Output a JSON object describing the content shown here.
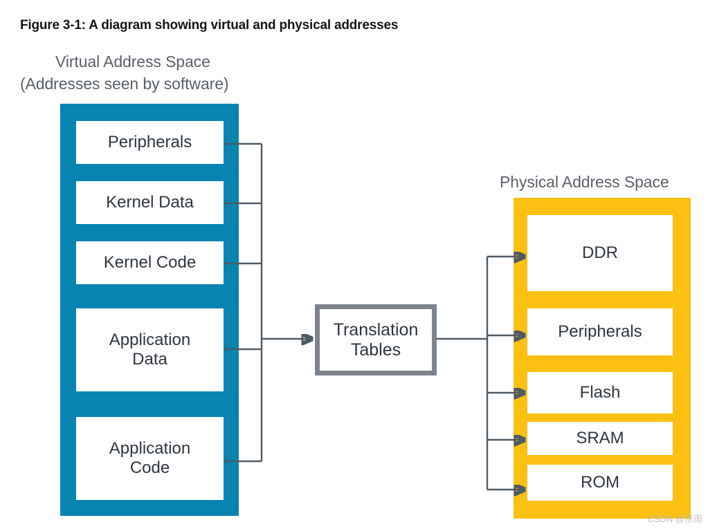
{
  "figure": {
    "caption": "Figure 3-1: A diagram showing virtual and physical addresses"
  },
  "virtual_space": {
    "title_line1": "Virtual Address Space",
    "title_line2": "(Addresses seen by software)",
    "container_color": "#0984b0",
    "blocks": [
      {
        "label": "Peripherals",
        "label_line1": "Peripherals",
        "label_line2": ""
      },
      {
        "label": "Kernel Data",
        "label_line1": "Kernel Data",
        "label_line2": ""
      },
      {
        "label": "Kernel Code",
        "label_line1": "Kernel Code",
        "label_line2": ""
      },
      {
        "label": "Application Data",
        "label_line1": "Application",
        "label_line2": "Data"
      },
      {
        "label": "Application Code",
        "label_line1": "Application",
        "label_line2": "Code"
      }
    ]
  },
  "translation": {
    "label_line1": "Translation",
    "label_line2": "Tables",
    "border_color": "#7d848c"
  },
  "physical_space": {
    "title": "Physical Address Space",
    "container_color": "#fbc011",
    "blocks": [
      {
        "label": "DDR"
      },
      {
        "label": "Peripherals"
      },
      {
        "label": "Flash"
      },
      {
        "label": "SRAM"
      },
      {
        "label": "ROM"
      }
    ]
  },
  "connectors": {
    "line_color": "#4e5a66"
  },
  "watermark": {
    "text": "CSDN @京雨"
  }
}
